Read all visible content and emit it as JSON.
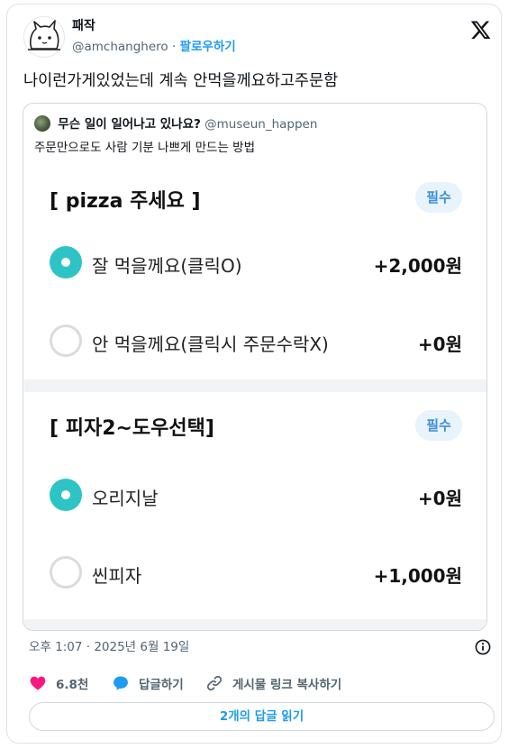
{
  "author": {
    "display_name": "패작",
    "handle": "@amchanghero",
    "separator": "·",
    "follow_label": "팔로우하기"
  },
  "tweet": {
    "text": "나이런가게있었는데 계속 안먹을께요하고주문함"
  },
  "quote": {
    "name": "무슨 일이 일어나고 있나요?",
    "handle": "@museun_happen",
    "text": "주문만으로도 사람 기분 나쁘게 만드는 방법"
  },
  "menu": {
    "sections": [
      {
        "title": "[ pizza 주세요 ]",
        "badge": "필수",
        "options": [
          {
            "label": "잘 먹을께요(클릭O)",
            "price": "+2,000원",
            "selected": true
          },
          {
            "label": "안 먹을께요(클릭시 주문수락X)",
            "price": "+0원",
            "selected": false
          }
        ]
      },
      {
        "title": "[ 피자2~도우선택]",
        "badge": "필수",
        "options": [
          {
            "label": "오리지날",
            "price": "+0원",
            "selected": true
          },
          {
            "label": "씬피자",
            "price": "+1,000원",
            "selected": false
          }
        ]
      }
    ]
  },
  "timestamp": "오후 1:07 · 2025년 6월 19일",
  "actions": {
    "likes": "6.8천",
    "reply_label": "답글하기",
    "copy_link_label": "게시물 링크 복사하기"
  },
  "read_replies_label": "2개의 답글 읽기",
  "colors": {
    "accent": "#1d9bf0",
    "like": "#f91880",
    "radio_selected": "#2ec4c6",
    "badge_bg": "#e8f3fb",
    "badge_text": "#3d8fd6"
  }
}
